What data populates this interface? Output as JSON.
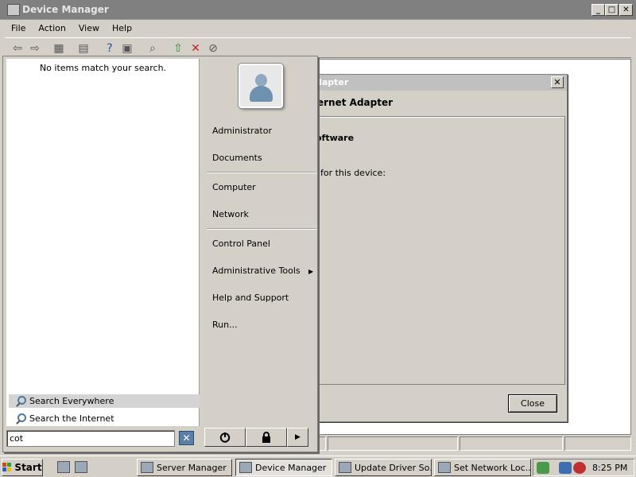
{
  "window": {
    "title": "Device Manager",
    "controls": [
      "_",
      "□",
      "✕"
    ]
  },
  "menu": [
    "File",
    "Action",
    "View",
    "Help"
  ],
  "toolbar_icons": [
    "back-icon",
    "forward-icon",
    "up-icon",
    "properties-icon",
    "help-icon",
    "console-icon",
    "scan-hardware-icon",
    "update-driver-icon",
    "uninstall-icon",
    "disable-icon"
  ],
  "dialog": {
    "title_partial": "dapter",
    "heading_partial": "ernet Adapter",
    "software_partial": "oftware",
    "subtext_partial": "for this device:",
    "close_label": "Close",
    "close_x": "✕"
  },
  "start_menu": {
    "no_items": "No items match your search.",
    "search_everywhere": "Search Everywhere",
    "search_internet": "Search the Internet",
    "search_value": "cot",
    "clear_glyph": "✕",
    "items": {
      "administrator": "Administrator",
      "documents": "Documents",
      "computer": "Computer",
      "network": "Network",
      "control_panel": "Control Panel",
      "admin_tools": "Administrative Tools",
      "help_support": "Help and Support",
      "run": "Run..."
    },
    "submenu_arrow": "▶",
    "more_arrow": "▶"
  },
  "taskbar": {
    "start_label": "Start",
    "tasks": [
      {
        "label": "Server Manager",
        "active": false
      },
      {
        "label": "Device Manager",
        "active": true
      },
      {
        "label": "Update Driver So...",
        "active": false
      },
      {
        "label": "Set Network Loc...",
        "active": false
      }
    ],
    "clock": "8:25 PM"
  }
}
